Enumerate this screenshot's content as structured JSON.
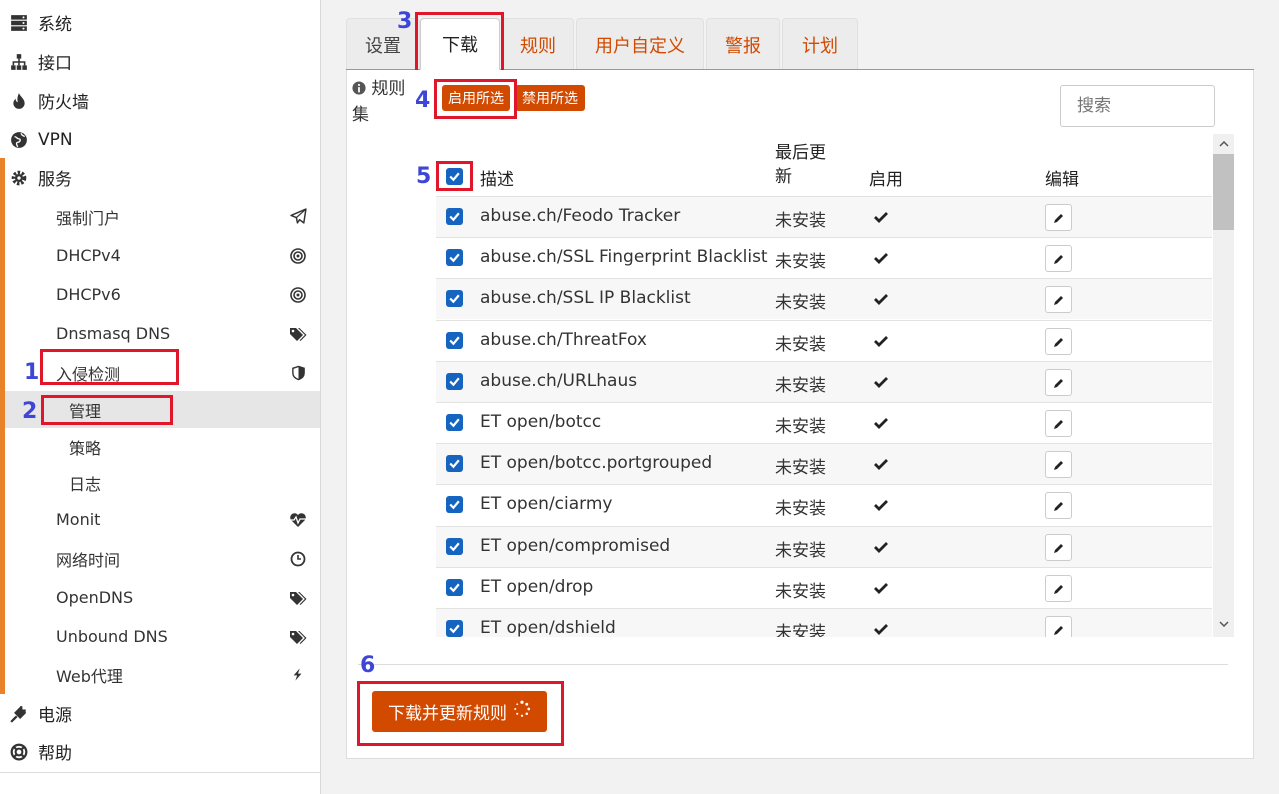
{
  "sidebar": {
    "top_items": [
      {
        "label": "系统",
        "icon": "server-icon"
      },
      {
        "label": "接口",
        "icon": "network-icon"
      },
      {
        "label": "防火墙",
        "icon": "fire-icon"
      },
      {
        "label": "VPN",
        "icon": "globe-icon"
      }
    ],
    "services": {
      "label": "服务",
      "icon": "gear-icon",
      "items": [
        {
          "label": "强制门户",
          "icon": "paper-plane-icon"
        },
        {
          "label": "DHCPv4",
          "icon": "bullseye-icon"
        },
        {
          "label": "DHCPv6",
          "icon": "bullseye-icon"
        },
        {
          "label": "Dnsmasq DNS",
          "icon": "tags-icon"
        },
        {
          "label": "入侵检测",
          "icon": "shield-icon"
        }
      ],
      "ids_children": [
        {
          "label": "管理",
          "active": true
        },
        {
          "label": "策略",
          "active": false
        },
        {
          "label": "日志",
          "active": false
        }
      ],
      "items_after": [
        {
          "label": "Monit",
          "icon": "heartbeat-icon"
        },
        {
          "label": "网络时间",
          "icon": "clock-icon"
        },
        {
          "label": "OpenDNS",
          "icon": "tags-icon"
        },
        {
          "label": "Unbound DNS",
          "icon": "tags-icon"
        },
        {
          "label": "Web代理",
          "icon": "bolt-icon"
        }
      ]
    },
    "bottom_items": [
      {
        "label": "电源",
        "icon": "plug-icon"
      },
      {
        "label": "帮助",
        "icon": "life-ring-icon"
      }
    ]
  },
  "tabs": [
    "设置",
    "下载",
    "规则",
    "用户自定义",
    "警报",
    "计划"
  ],
  "active_tab": "下载",
  "ruleset_label": "规则集",
  "buttons": {
    "enable_selected": "启用所选",
    "disable_selected": "禁用所选",
    "download_update": "下载并更新规则"
  },
  "search": {
    "placeholder": "搜索"
  },
  "table": {
    "headers": {
      "description": "描述",
      "last_updated": "最后更新",
      "enabled": "启用",
      "edit": "编辑"
    },
    "rows": [
      {
        "description": "abuse.ch/Feodo Tracker",
        "status": "未安装"
      },
      {
        "description": "abuse.ch/SSL Fingerprint Blacklist",
        "status": "未安装"
      },
      {
        "description": "abuse.ch/SSL IP Blacklist",
        "status": "未安装"
      },
      {
        "description": "abuse.ch/ThreatFox",
        "status": "未安装"
      },
      {
        "description": "abuse.ch/URLhaus",
        "status": "未安装"
      },
      {
        "description": "ET open/botcc",
        "status": "未安装"
      },
      {
        "description": "ET open/botcc.portgrouped",
        "status": "未安装"
      },
      {
        "description": "ET open/ciarmy",
        "status": "未安装"
      },
      {
        "description": "ET open/compromised",
        "status": "未安装"
      },
      {
        "description": "ET open/drop",
        "status": "未安装"
      },
      {
        "description": "ET open/dshield",
        "status": "未安装"
      }
    ]
  },
  "annotations": [
    "1",
    "2",
    "3",
    "4",
    "5",
    "6"
  ],
  "colors": {
    "accent": "#d14a00",
    "sidebar_stripe": "#e8832a",
    "checkbox": "#1565c0",
    "annotation": "#3d46d6",
    "highlight_box": "#e0162b"
  }
}
